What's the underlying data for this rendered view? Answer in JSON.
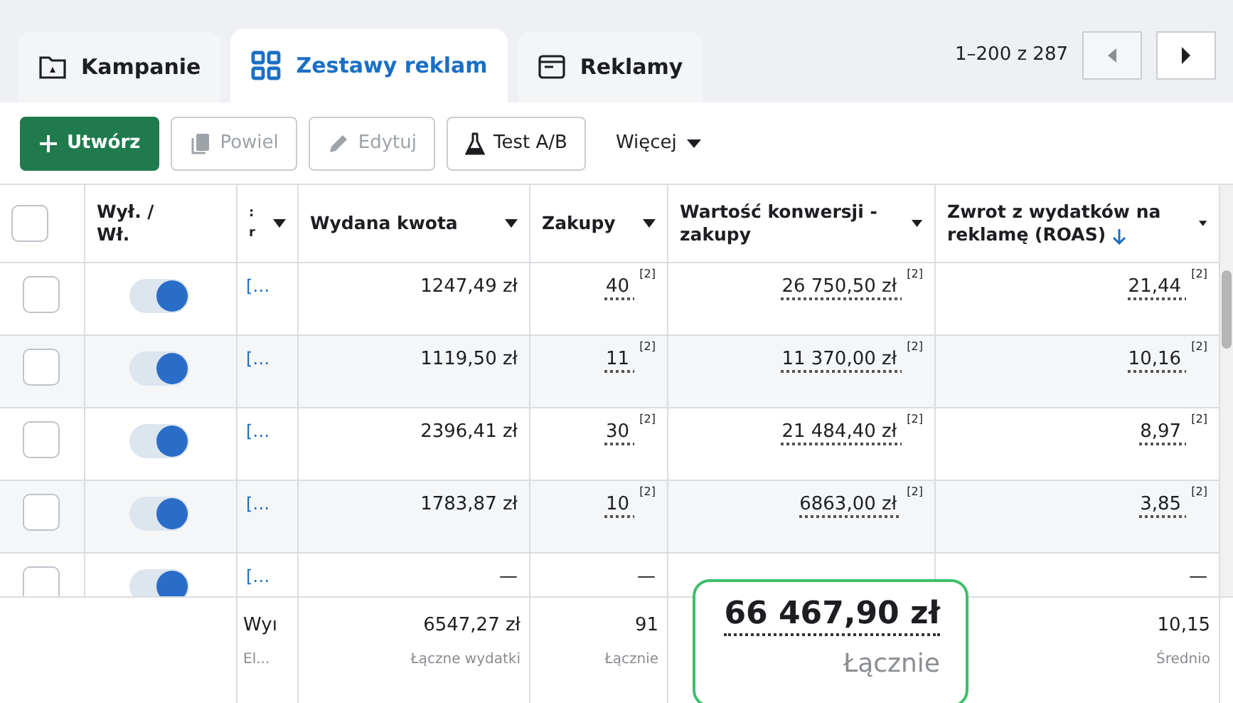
{
  "tabs": [
    {
      "label": "Kampanie",
      "selected": false
    },
    {
      "label": "Zestawy reklam",
      "selected": true
    },
    {
      "label": "Reklamy",
      "selected": false
    }
  ],
  "pagination": {
    "range": "1–200 z 287",
    "prev_disabled": true
  },
  "toolbar": [
    {
      "label": "Utwórz",
      "kind": "primary",
      "disabled": false
    },
    {
      "label": "Powiel",
      "kind": "outline",
      "disabled": true
    },
    {
      "label": "Edytuj",
      "kind": "outline",
      "disabled": true
    },
    {
      "label": "Test A/B",
      "kind": "outline",
      "disabled": false
    },
    {
      "label": "Więcej",
      "kind": "plain",
      "disabled": false
    }
  ],
  "table": {
    "all_selected": false,
    "columns": [
      {
        "kind": "check"
      },
      {
        "label": "Wył. / Wł.",
        "kind": "toggle"
      },
      {
        "label": ": r",
        "kind": "text",
        "menu": true
      },
      {
        "label": "Wydana kwota",
        "kind": "num",
        "menu": true
      },
      {
        "label": "Zakupy",
        "kind": "num",
        "menu": true
      },
      {
        "label": "Wartość konwersji - zakupy",
        "kind": "num",
        "menu": true
      },
      {
        "label": "Zwrot z wydatków na reklamę (ROAS)",
        "kind": "num",
        "menu": true,
        "sorted": true
      }
    ],
    "rows": [
      {
        "selected": false,
        "on": true,
        "name": "[…",
        "spend": "1247,49 zł",
        "purchases": "40 $^{[2]}$",
        "value": "26 750,50 zł $^{[2]}$",
        "roas": "21,44 $^{[2]}$",
        "underlined": true
      },
      {
        "selected": false,
        "on": true,
        "name": "[…",
        "spend": "1119,50 zł",
        "purchases": "11 $^{[2]}$",
        "value": "11 370,00 zł $^{[2]}$",
        "roas": "10,16 $^{[2]}$",
        "underlined": true
      },
      {
        "selected": false,
        "on": true,
        "name": "[…",
        "spend": "2396,41 zł",
        "purchases": "30 $^{[2]}$",
        "value": "21 484,40 zł $^{[2]}$",
        "roas": "8,97 $^{[2]}$",
        "underlined": true
      },
      {
        "selected": false,
        "on": true,
        "name": "[…",
        "spend": "1783,87 zł",
        "purchases": "10 $^{[2]}$",
        "value": "6863,00 zł $^{[2]}$",
        "roas": "3,85 $^{[2]}$",
        "underlined": true
      },
      {
        "selected": false,
        "on": true,
        "name": "[…",
        "spend": "—",
        "purchases": "—",
        "roas": "—",
        "underlined": false
      }
    ],
    "totals": [
      {
        "value": "Wyı",
        "caption": "El...",
        "highlighted": false
      },
      {
        "value": "6547,27 zł",
        "caption": "Łączne wydatki",
        "highlighted": false
      },
      {
        "value": "91",
        "caption": "Łącznie",
        "highlighted": false
      },
      {
        "value": "66 467,90 zł",
        "caption": "Łącznie",
        "highlighted": true
      },
      {
        "value": "10,15",
        "caption": "Średnio",
        "highlighted": false
      }
    ]
  }
}
